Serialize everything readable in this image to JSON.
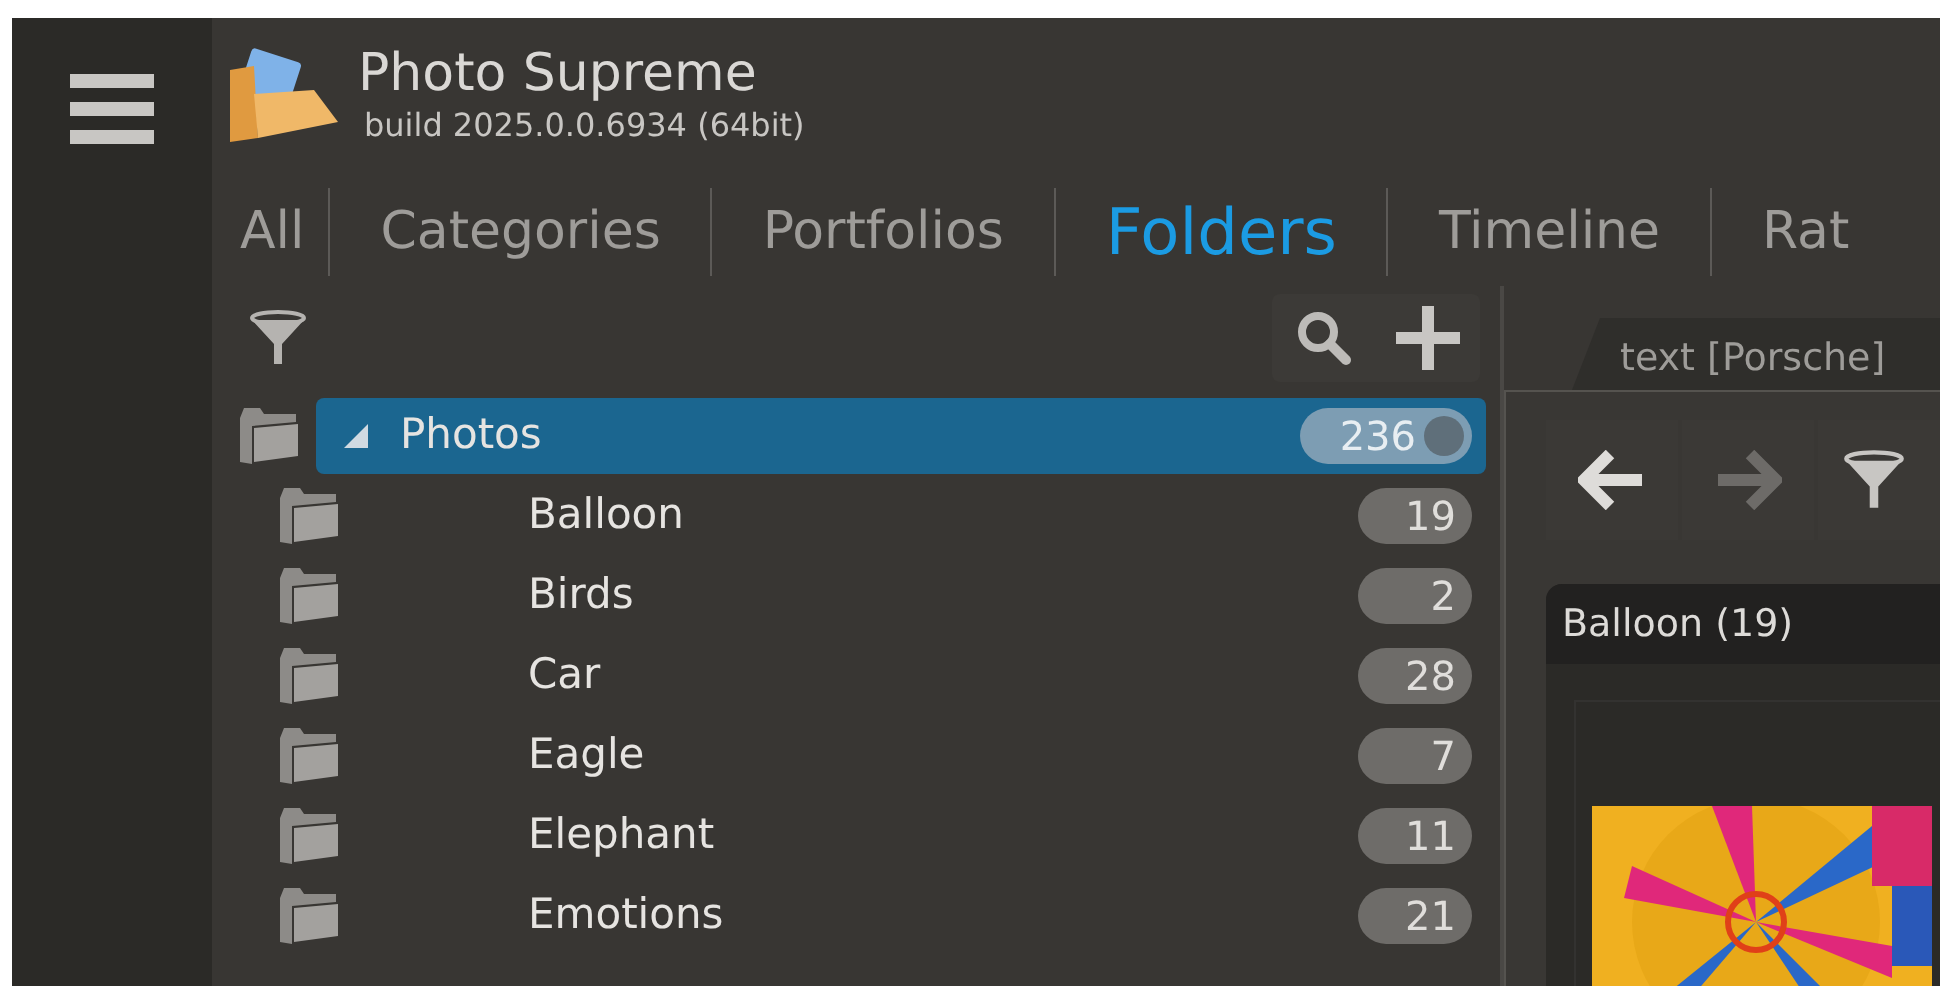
{
  "app": {
    "title": "Photo Supreme",
    "build": "build 2025.0.0.6934 (64bit)"
  },
  "tabs": [
    {
      "label": "All",
      "selected": false
    },
    {
      "label": "Categories",
      "selected": false
    },
    {
      "label": "Portfolios",
      "selected": false
    },
    {
      "label": "Folders",
      "selected": true
    },
    {
      "label": "Timeline",
      "selected": false
    },
    {
      "label": "Rat",
      "selected": false
    }
  ],
  "tree": [
    {
      "label": "Photos",
      "count": "236",
      "selected": true,
      "expanded": true,
      "children": [
        {
          "label": "Balloon",
          "count": "19",
          "selected": false
        },
        {
          "label": "Birds",
          "count": "2",
          "selected": false
        },
        {
          "label": "Car",
          "count": "28",
          "selected": false
        },
        {
          "label": "Eagle",
          "count": "7",
          "selected": false
        },
        {
          "label": "Elephant",
          "count": "11",
          "selected": false
        },
        {
          "label": "Emotions",
          "count": "21",
          "selected": false
        }
      ]
    }
  ],
  "right_panel": {
    "tab": "text [Porsche]",
    "back_disabled": false,
    "forward_disabled": true,
    "group_title": "Balloon (19)"
  }
}
